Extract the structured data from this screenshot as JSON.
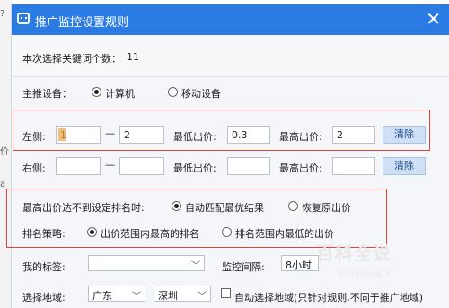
{
  "window": {
    "title": "推广监控设置规则",
    "close_glyph": "✕"
  },
  "left_edge": {
    "text_a": "?",
    "text_b": "a",
    "text_c": "价"
  },
  "selection": {
    "label": "本次选择关键词个数：",
    "count": "11"
  },
  "device": {
    "label": "主推设备：",
    "options": [
      {
        "label": "计算机",
        "selected": true
      },
      {
        "label": "移动设备",
        "selected": false
      }
    ]
  },
  "left_row": {
    "label": "左侧:",
    "from": "1",
    "dash": "—",
    "to": "2",
    "min_label": "最低出价:",
    "min_value": "0.3",
    "max_label": "最高出价:",
    "max_value": "2",
    "clear_label": "清除"
  },
  "right_row": {
    "label": "右侧:",
    "from": "",
    "dash": "—",
    "to": "",
    "min_label": "最低出价:",
    "min_value": "",
    "max_label": "最高出价:",
    "max_value": "",
    "clear_label": "清除"
  },
  "fallback": {
    "label": "最高出价达不到设定排名时:",
    "options": [
      {
        "label": "自动匹配最优结果",
        "selected": true
      },
      {
        "label": "恢复原出价",
        "selected": false
      }
    ]
  },
  "strategy": {
    "label": "排名策略:",
    "options": [
      {
        "label": "出价范围内最高的排名",
        "selected": true
      },
      {
        "label": "排名范围内最低的出价",
        "selected": false
      }
    ]
  },
  "tags": {
    "label": "我的标签:",
    "value": ""
  },
  "interval": {
    "label": "监控间隔:",
    "value": "8小时"
  },
  "region": {
    "label": "选择地域:",
    "province": "广东",
    "city": "深圳",
    "auto_label": "自动选择地域(只针对规则,不同于推广地域)",
    "auto_checked": false
  },
  "watermark": {
    "title": "百科全说",
    "subtitle": "助你轻松解决"
  },
  "colors": {
    "titlebar": "#2b7be4",
    "highlight_border": "#e0443a",
    "button": "#cfe0f5"
  }
}
